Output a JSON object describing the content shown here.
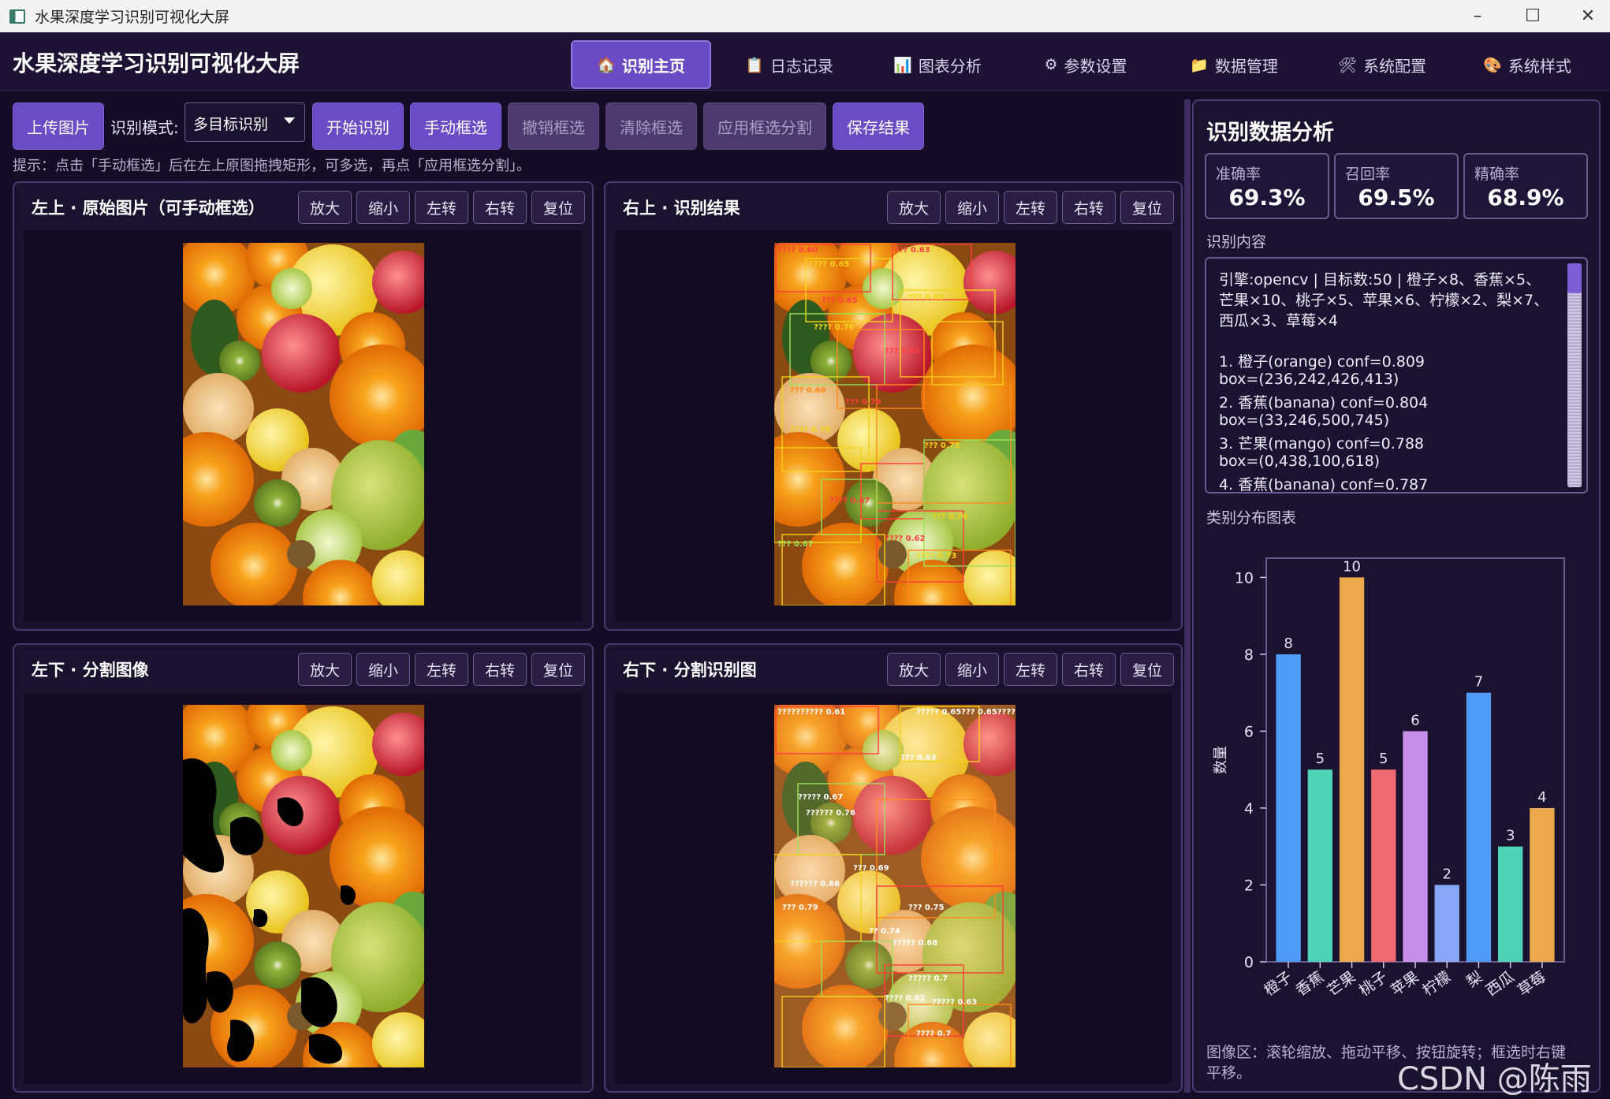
{
  "window": {
    "title": "水果深度学习识别可视化大屏"
  },
  "app": {
    "title": "水果深度学习识别可视化大屏"
  },
  "nav": {
    "tabs": [
      {
        "icon": "🏠",
        "label": "识别主页",
        "active": true
      },
      {
        "icon": "📋",
        "label": "日志记录"
      },
      {
        "icon": "📊",
        "label": "图表分析"
      },
      {
        "icon": "⚙",
        "label": "参数设置"
      },
      {
        "icon": "📁",
        "label": "数据管理"
      },
      {
        "icon": "🛠",
        "label": "系统配置"
      },
      {
        "icon": "🎨",
        "label": "系统样式"
      }
    ]
  },
  "toolbar": {
    "upload": "上传图片",
    "mode_label": "识别模式:",
    "mode_value": "多目标识别",
    "start": "开始识别",
    "manual_box": "手动框选",
    "undo_box": "撤销框选",
    "clear_box": "清除框选",
    "apply_seg": "应用框选分割",
    "save": "保存结果",
    "hint": "提示：点击「手动框选」后在左上原图拖拽矩形，可多选，再点「应用框选分割」。"
  },
  "panel_buttons": {
    "zoom_in": "放大",
    "zoom_out": "缩小",
    "rot_left": "左转",
    "rot_right": "右转",
    "reset": "复位"
  },
  "panels": {
    "tl": "左上 · 原始图片（可手动框选）",
    "tr": "右上 · 识别结果",
    "bl": "左下 · 分割图像",
    "br": "右下 · 分割识别图"
  },
  "analysis": {
    "title": "识别数据分析",
    "metrics": [
      {
        "label": "准确率",
        "value": "69.3%"
      },
      {
        "label": "召回率",
        "value": "69.5%"
      },
      {
        "label": "精确率",
        "value": "68.9%"
      }
    ],
    "content_label": "识别内容",
    "content_lines": [
      "引擎:opencv | 目标数:50 | 橙子×8、香蕉×5、",
      "芒果×10、桃子×5、苹果×6、柠檬×2、梨×7、",
      "西瓜×3、草莓×4",
      "",
      "1. 橙子(orange)  conf=0.809",
      "box=(236,242,426,413)",
      "2. 香蕉(banana)  conf=0.804",
      "box=(33,246,500,745)",
      "3. 芒果(mango)  conf=0.788",
      "box=(0,438,100,618)",
      "4. 香蕉(banana)  conf=0.787"
    ],
    "chart_label": "类别分布图表",
    "footer": [
      "图像区：滚轮缩放、拖动平移、按钮旋转；框选时右键",
      "平移。"
    ]
  },
  "chart_data": {
    "type": "bar",
    "categories": [
      "橙子",
      "香蕉",
      "芒果",
      "桃子",
      "苹果",
      "柠檬",
      "梨",
      "西瓜",
      "草莓"
    ],
    "values": [
      8,
      5,
      10,
      5,
      6,
      2,
      7,
      3,
      4
    ],
    "colors": [
      "#4e9cf5",
      "#4fd3b7",
      "#eba94a",
      "#ef6b72",
      "#c88fe8",
      "#86a8f7",
      "#4e9cf5",
      "#4fd3b7",
      "#eba94a"
    ],
    "xlabel": "",
    "ylabel": "数量",
    "ylim": [
      0,
      10.5
    ],
    "yticks": [
      0,
      2,
      4,
      6,
      8,
      10
    ],
    "grid": false
  },
  "watermark": "CSDN @陈雨文"
}
